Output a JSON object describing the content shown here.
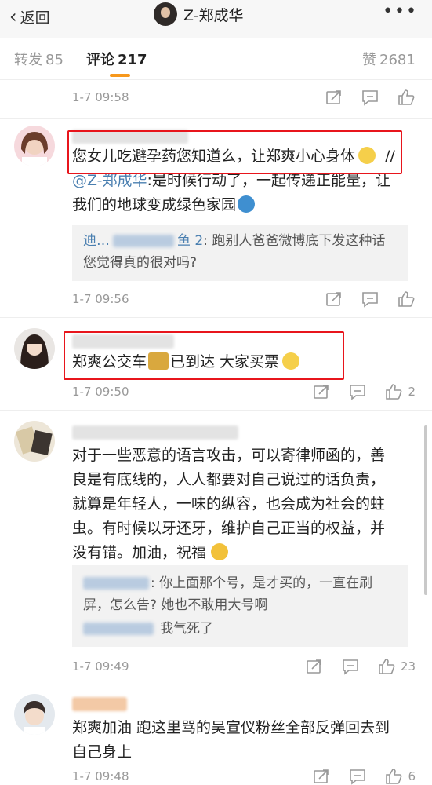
{
  "header": {
    "back_label": "返回",
    "title": "Z-郑成华",
    "more_label": "•••"
  },
  "tabs": [
    {
      "label": "转发",
      "count": "85"
    },
    {
      "label": "评论",
      "count": "217"
    },
    {
      "label": "赞",
      "count": "2681"
    }
  ],
  "top_meta": {
    "time": "1-7 09:58"
  },
  "comments": [
    {
      "text_line1": "您女儿吃避孕药您知道么，让郑爽小心身体",
      "text_line1_tail": "//",
      "mention": "@Z-郑成华",
      "text_line2_tail": ":是时候行动了，一起传递正能量，让",
      "text_line3": "我们的地球变成绿色家园",
      "reply_name_visible": "迪…",
      "reply_name_tail": "鱼 2",
      "reply_line1": ": 跑别人爸爸微博底下发这种话",
      "reply_line2": "您觉得真的很对吗?",
      "time": "1-7 09:56",
      "likes": ""
    },
    {
      "text_line1": "郑爽公交车",
      "text_line1_mid": "已到达 大家买票",
      "time": "1-7 09:50",
      "likes": "2"
    },
    {
      "text": [
        "对于一些恶意的语言攻击，可以寄律师函的，善",
        "良是有底线的，人人都要对自己说过的话负责，",
        "就算是年轻人，一味的纵容，也会成为社会的蛀",
        "虫。有时候以牙还牙，维护自己正当的权益，并",
        "没有错。加油，祝福"
      ],
      "reply_line1": ": 你上面那个号，是才买的，一直在刷",
      "reply_line2": "屏，怎么告? 她也不敢用大号啊",
      "reply_line3": "我气死了",
      "time": "1-7 09:49",
      "likes": "23"
    },
    {
      "text": [
        "郑爽加油 跑这里骂的吴宣仪粉丝全部反弹回去到",
        "自己身上"
      ],
      "time": "1-7 09:48",
      "likes": "6"
    }
  ],
  "colors": {
    "accent": "#f7981d",
    "highlight_box": "#e8151c",
    "link": "#4a7fb0"
  }
}
